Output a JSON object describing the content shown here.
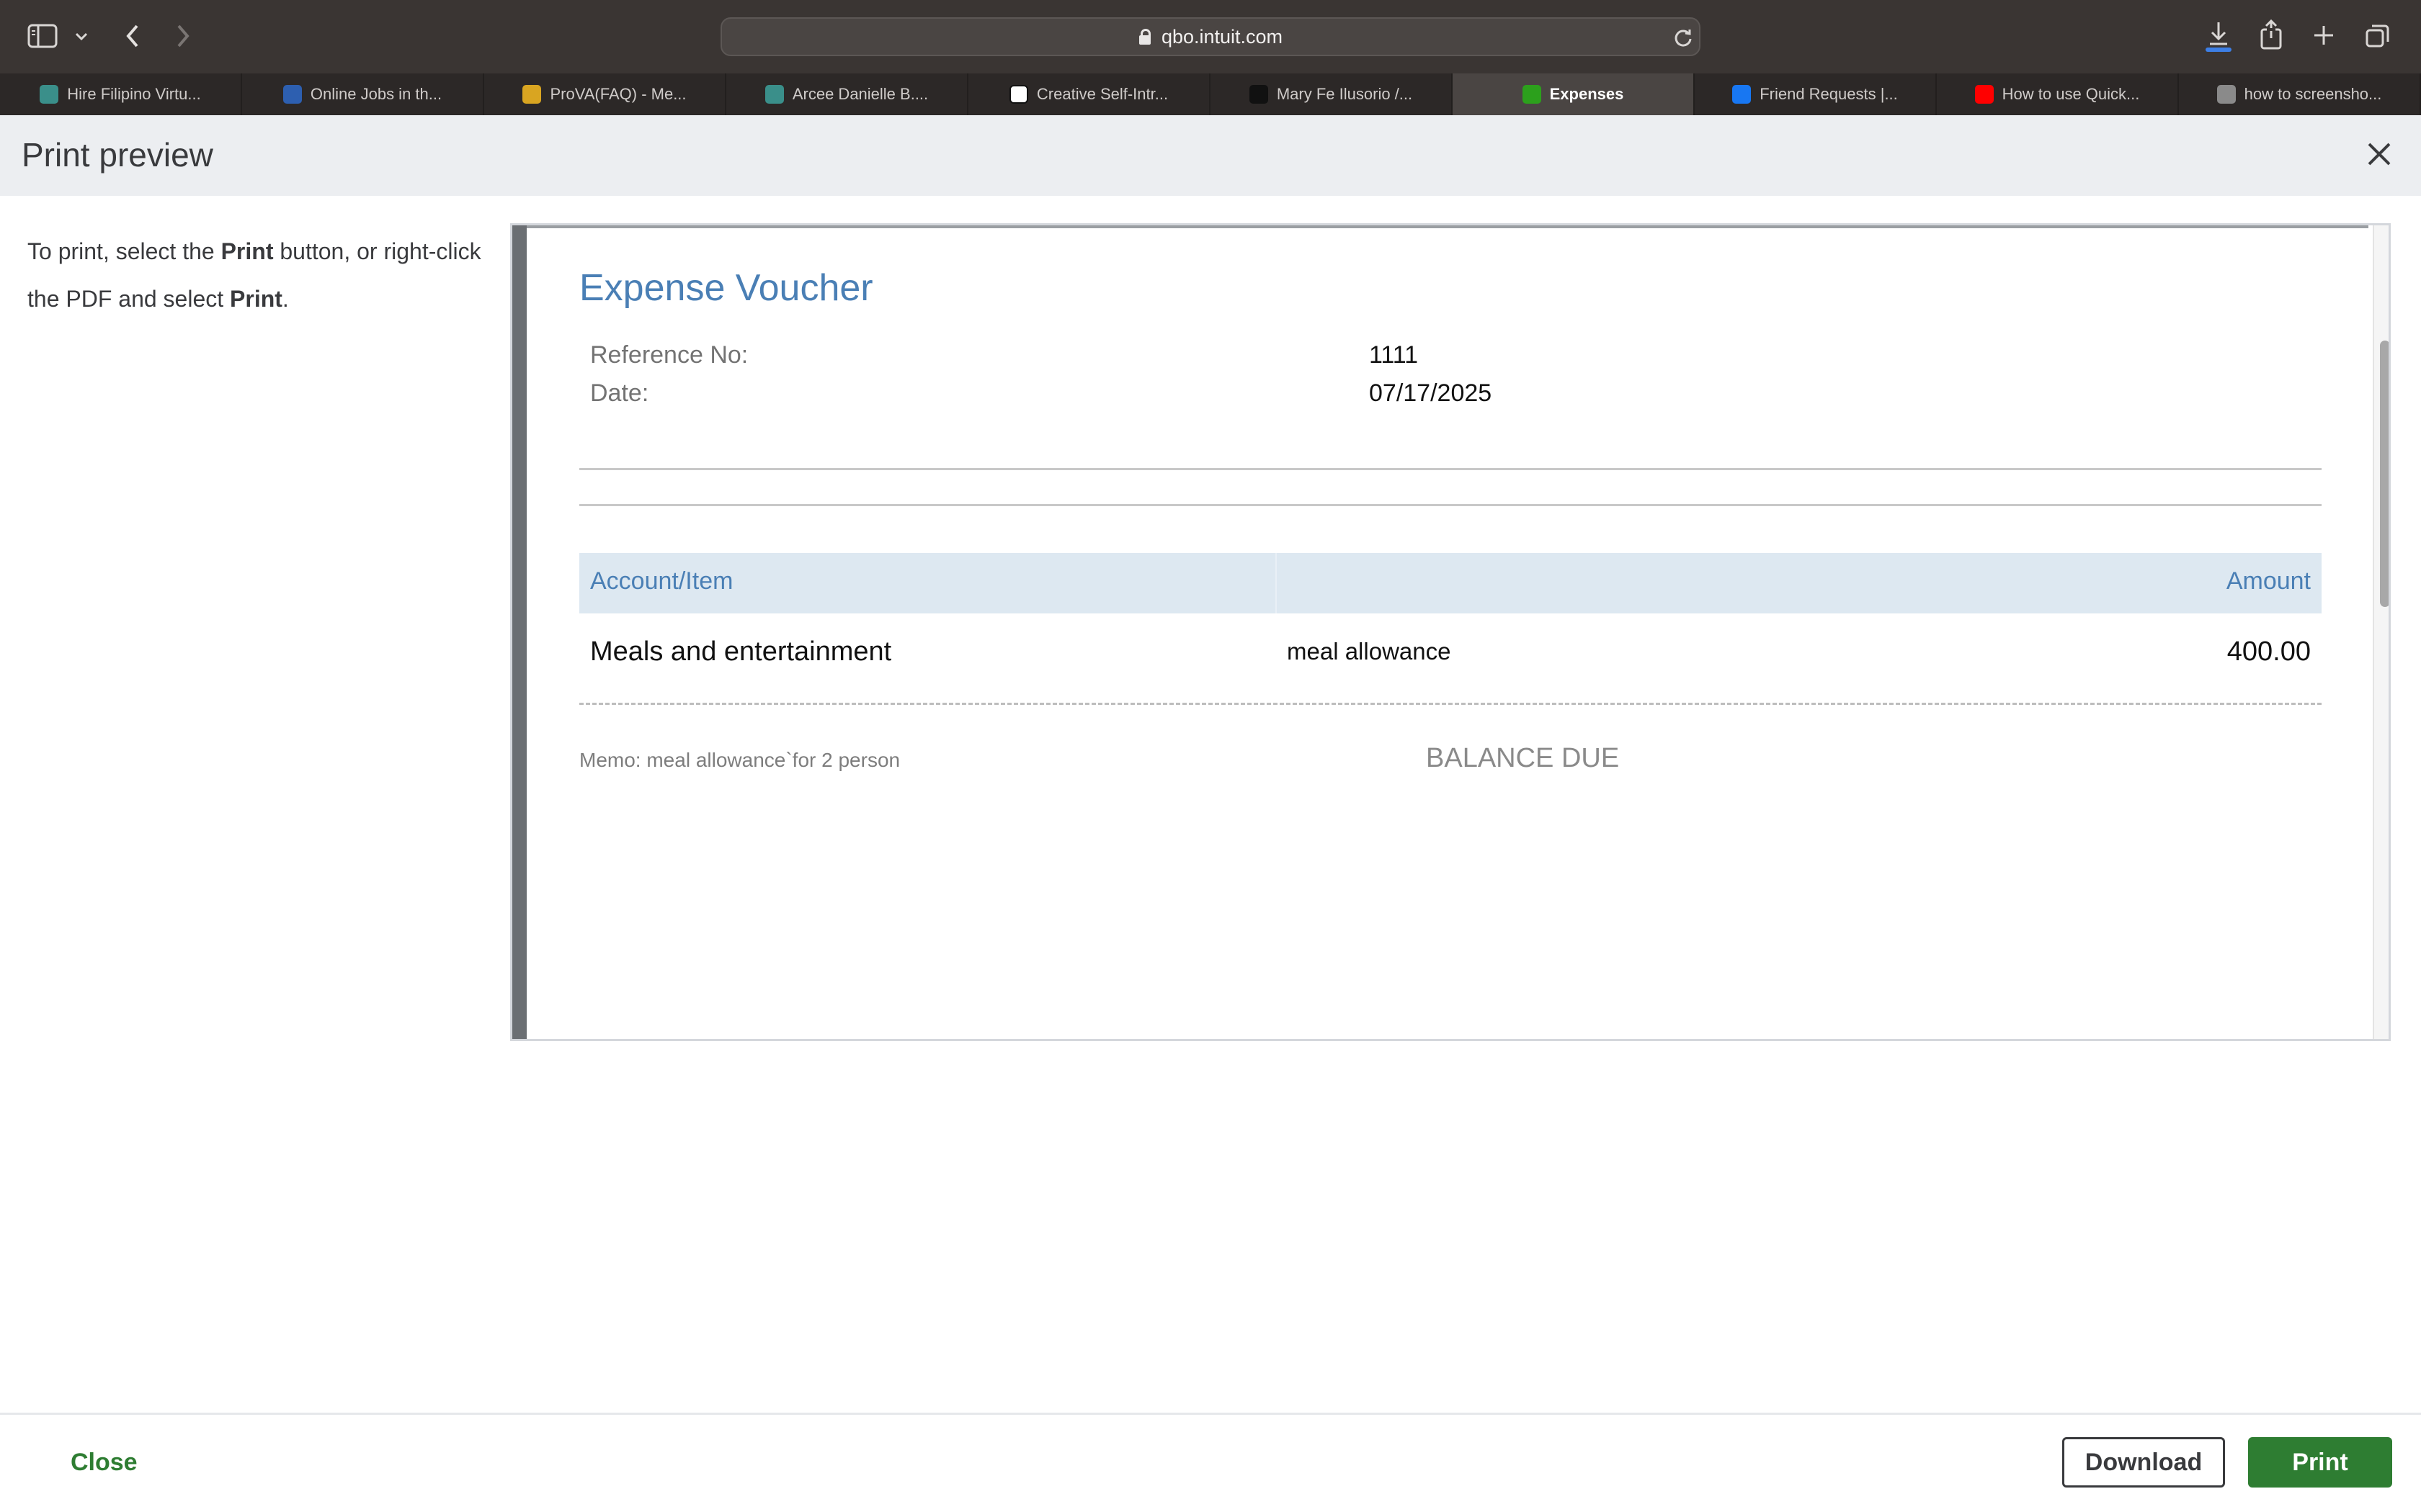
{
  "browser": {
    "url": "qbo.intuit.com",
    "tabs": [
      {
        "label": "Hire Filipino Virtu...",
        "icon": "onlinejobs-favicon",
        "color": "#3a8f8a",
        "active": false
      },
      {
        "label": "Online Jobs in th...",
        "icon": "onlinejobs-ph-favicon",
        "color": "#2d5fb0",
        "active": false
      },
      {
        "label": "ProVA(FAQ) - Me...",
        "icon": "va-favicon",
        "color": "#d9a521",
        "active": false
      },
      {
        "label": "Arcee Danielle B....",
        "icon": "onlinejobs-favicon",
        "color": "#3a8f8a",
        "active": false
      },
      {
        "label": "Creative Self-Intr...",
        "icon": "openai-favicon",
        "color": "#ffffff",
        "active": false
      },
      {
        "label": "Mary Fe Ilusorio /...",
        "icon": "terminal-favicon",
        "color": "#111111",
        "active": false
      },
      {
        "label": "Expenses",
        "icon": "quickbooks-favicon",
        "color": "#2ca01c",
        "active": true
      },
      {
        "label": "Friend Requests |...",
        "icon": "facebook-favicon",
        "color": "#1877f2",
        "active": false
      },
      {
        "label": "How to use Quick...",
        "icon": "youtube-favicon",
        "color": "#ff0000",
        "active": false
      },
      {
        "label": "how to screensho...",
        "icon": "google-favicon",
        "color": "#8a8a8a",
        "active": false
      }
    ]
  },
  "modal": {
    "title": "Print preview",
    "instructions": {
      "part1": "To print, select the ",
      "bold1": "Print",
      "part2": " button, or right-click the PDF and select ",
      "bold2": "Print",
      "part3": "."
    }
  },
  "voucher": {
    "title": "Expense Voucher",
    "reference_label": "Reference No:",
    "reference_value": "1111",
    "date_label": "Date:",
    "date_value": "07/17/2025",
    "col_account": "Account/Item",
    "col_amount": "Amount",
    "line": {
      "account": "Meals and entertainment",
      "description": "meal allowance",
      "amount": "400.00"
    },
    "memo": "Memo: meal allowance`for 2 person",
    "balance_due_label": "BALANCE DUE"
  },
  "footer": {
    "close_label": "Close",
    "download_label": "Download",
    "print_label": "Print"
  },
  "colors": {
    "accent_green": "#2e7d32",
    "voucher_blue": "#4a7fb5"
  }
}
